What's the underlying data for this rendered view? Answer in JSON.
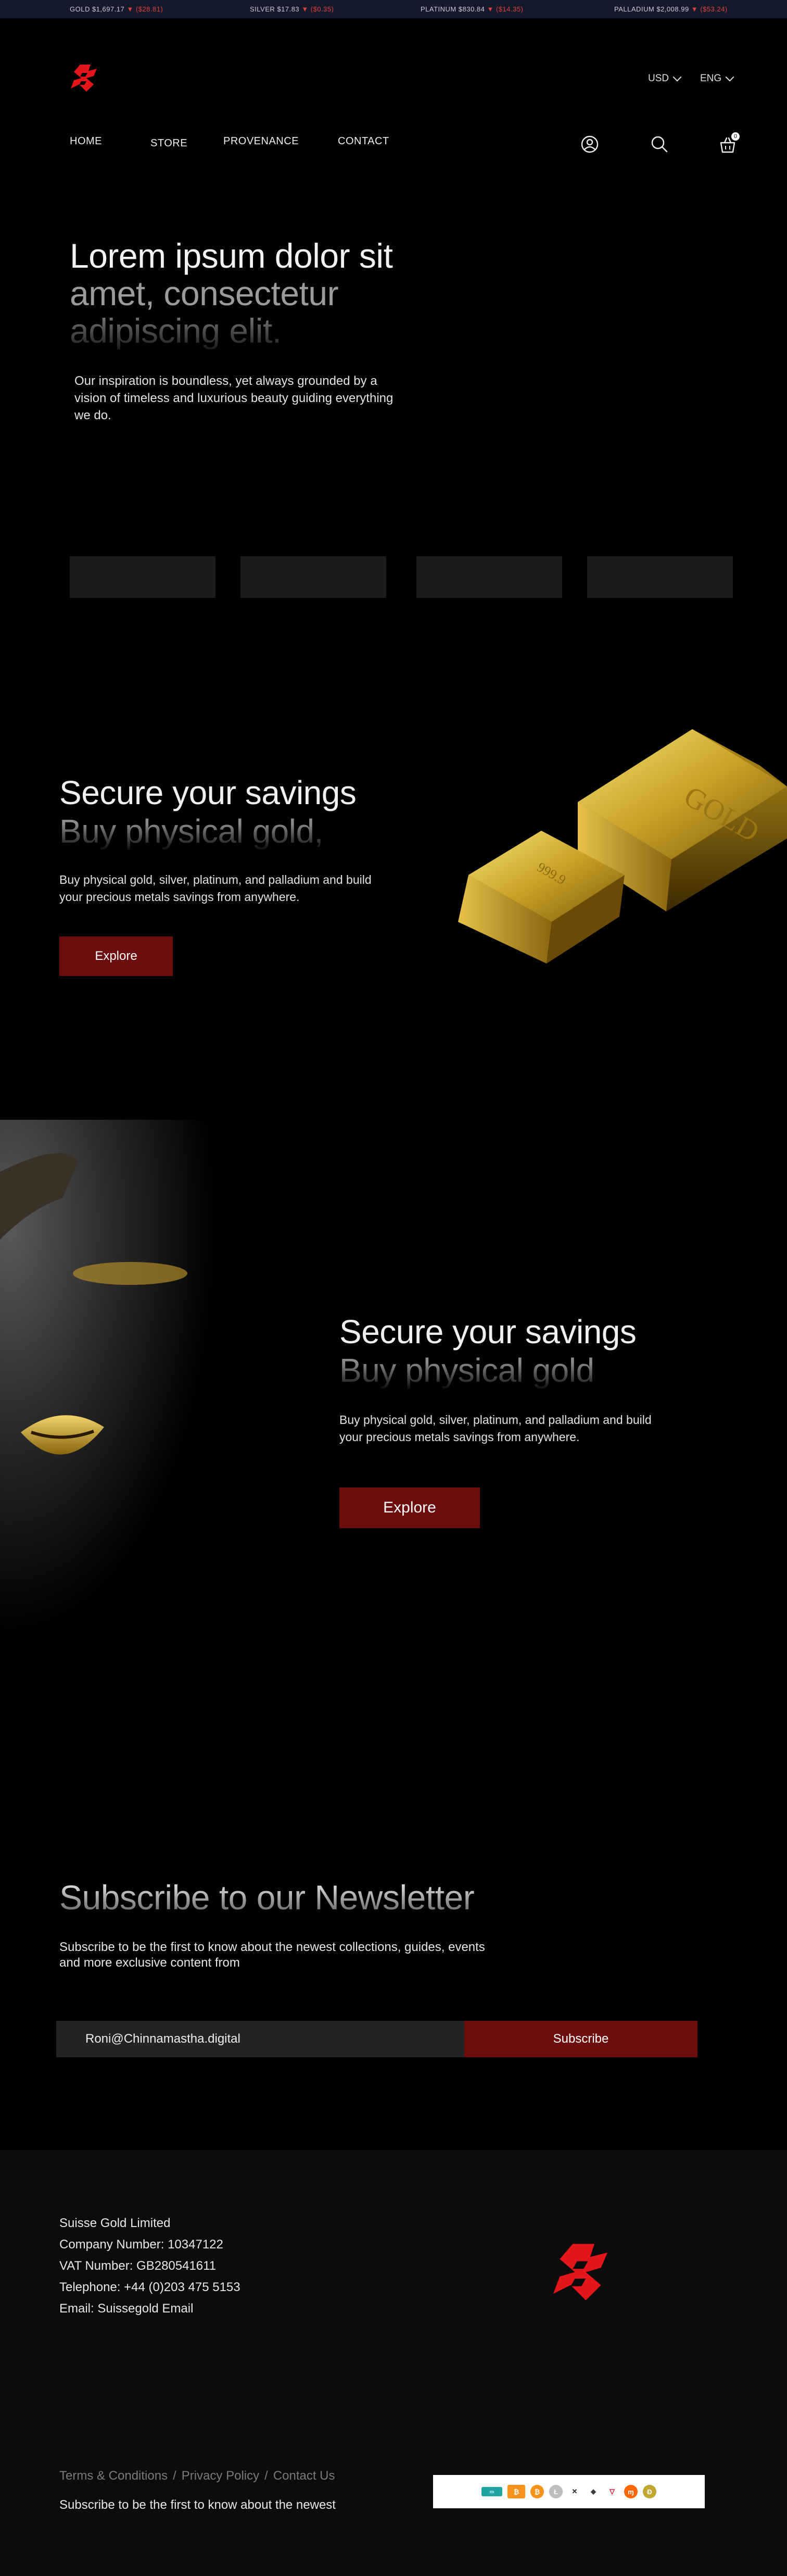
{
  "ticker": [
    {
      "label": "GOLD $1,697.17",
      "arrow": "▼",
      "change": "($28.81)"
    },
    {
      "label": "SILVER $17.83",
      "arrow": "▼",
      "change": "($0.35)"
    },
    {
      "label": "PLATINUM $830.84",
      "arrow": "▼",
      "change": "($14.35)"
    },
    {
      "label": "PALLADIUM $2,008.99",
      "arrow": "▼",
      "change": "($53.24)"
    }
  ],
  "header": {
    "currency": "USD",
    "language": "ENG",
    "cart_count": "0",
    "nav": [
      "HOME",
      "STORE",
      "PROVENANCE",
      "CONTACT"
    ]
  },
  "hero": {
    "line1": "Lorem ipsum dolor sit",
    "line2": "amet, consectetur",
    "line3": "adipiscing elit.",
    "description": "Our inspiration is boundless, yet always grounded by a vision of timeless and luxurious beauty guiding everything we do."
  },
  "gold_section": {
    "title1": "Secure your savings",
    "title2": "Buy physical gold,",
    "description": "Buy physical gold, silver, platinum, and palladium and build your precious metals savings from anywhere.",
    "button": "Explore",
    "bar_text_small": "999.9",
    "bar_text_large": "GOLD"
  },
  "model_section": {
    "title1": "Secure your savings",
    "title2": "Buy physical gold",
    "description": "Buy physical gold, silver, platinum, and palladium and build your precious metals savings from anywhere.",
    "button": "Explore"
  },
  "newsletter": {
    "title": "Subscribe to our Newsletter",
    "description": "Subscribe to be the first to know about the newest collections, guides, events and more exclusive content from",
    "email_value": "Roni@Chinnamastha.digital",
    "button": "Subscribe"
  },
  "footer": {
    "company": "Suisse Gold Limited",
    "company_number": "Company Number: 10347122",
    "vat": "VAT Number: GB280541611",
    "telephone": "Telephone: +44 (0)203 475 5153",
    "email": "Email: Suissegold Email",
    "links": [
      "Terms & Conditions",
      "Privacy Policy",
      "Contact Us"
    ],
    "separator": "/",
    "subscribe_text": "Subscribe to be the first to know about the newest",
    "payment_icons": [
      "bank-transfer-icon",
      "bitcoin-icon",
      "bitcoin-cash-icon",
      "litecoin-icon",
      "ripple-icon",
      "ethereum-icon",
      "tron-icon",
      "monero-icon",
      "dogecoin-icon"
    ]
  },
  "colors": {
    "accent": "#6e0d0e",
    "logo_red": "#e3161b",
    "ticker_bg": "#141a2b",
    "ticker_down": "#e0413c"
  }
}
